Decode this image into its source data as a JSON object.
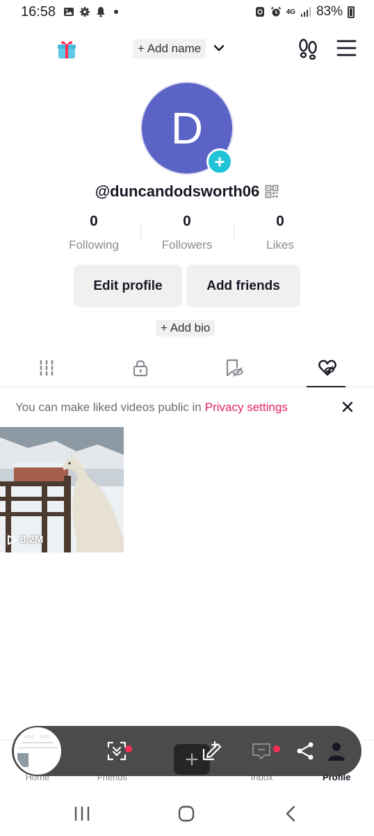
{
  "status_bar": {
    "time": "16:58",
    "network": "4G",
    "battery": "83%"
  },
  "header": {
    "add_name_label": "+ Add name",
    "icons": [
      "gift-icon",
      "chevron-down-icon",
      "footprint-icon",
      "menu-icon"
    ]
  },
  "profile": {
    "avatar_letter": "D",
    "avatar_color": "#5b63c6",
    "username": "@duncandodsworth06",
    "stats": [
      {
        "value": "0",
        "label": "Following"
      },
      {
        "value": "0",
        "label": "Followers"
      },
      {
        "value": "0",
        "label": "Likes"
      }
    ],
    "edit_profile_label": "Edit profile",
    "add_friends_label": "Add friends",
    "add_bio_label": "+ Add bio"
  },
  "tabs": [
    {
      "icon": "grid-icon",
      "active": false
    },
    {
      "icon": "lock-icon",
      "active": false
    },
    {
      "icon": "bookmark-hidden-icon",
      "active": false
    },
    {
      "icon": "liked-hidden-icon",
      "active": true
    }
  ],
  "notice": {
    "text": "You can make liked videos public in",
    "link": "Privacy settings",
    "link_color": "#e0245e"
  },
  "videos": [
    {
      "views": "8.2M",
      "subject": "llama in snow"
    }
  ],
  "bottom_nav": {
    "home": "Home",
    "friends": "Friends",
    "inbox": "Inbox",
    "profile": "Profile"
  },
  "colors": {
    "accent_red": "#fe2c55",
    "accent_cyan": "#20c3d8",
    "button_bg": "#f0f0f1"
  }
}
